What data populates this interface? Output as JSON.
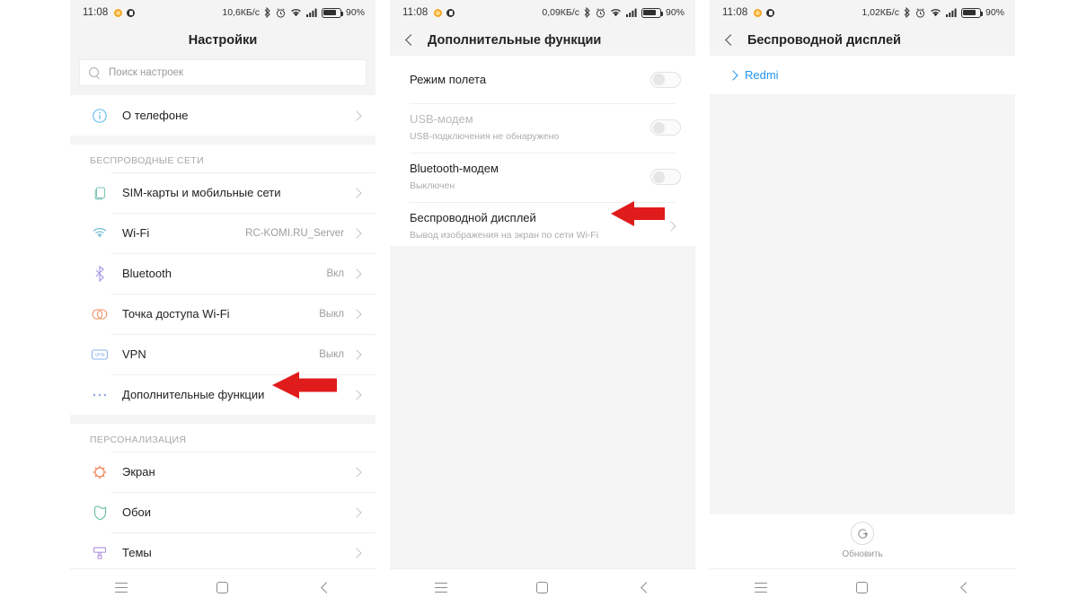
{
  "status_bar": {
    "time": "11:08",
    "battery_percent": "90%",
    "speeds": {
      "p1": "10,6КБ/c",
      "p2": "0,09КБ/c",
      "p3": "1,02КБ/c"
    },
    "icons": [
      "weather-dot-icon",
      "app-dot-icon",
      "bluetooth-icon",
      "alarm-icon",
      "wifi-icon",
      "signal-icon",
      "battery-icon"
    ]
  },
  "panel1": {
    "title": "Настройки",
    "search": {
      "placeholder": "Поиск настроек"
    },
    "about_row": {
      "label": "О телефоне",
      "icon": "info-circle-icon"
    },
    "group1_header": "БЕСПРОВОДНЫЕ СЕТИ",
    "group1_rows": [
      {
        "label": "SIM-карты и мобильные сети",
        "value": "",
        "icon": "sim-card-icon"
      },
      {
        "label": "Wi-Fi",
        "value": "RC-KOMI.RU_Server",
        "icon": "wifi-icon"
      },
      {
        "label": "Bluetooth",
        "value": "Вкл",
        "icon": "bluetooth-icon"
      },
      {
        "label": "Точка доступа Wi-Fi",
        "value": "Выкл",
        "icon": "hotspot-icon"
      },
      {
        "label": "VPN",
        "value": "Выкл",
        "icon": "vpn-icon"
      },
      {
        "label": "Дополнительные функции",
        "value": "",
        "icon": "more-dots-icon"
      }
    ],
    "group2_header": "ПЕРСОНАЛИЗАЦИЯ",
    "group2_rows": [
      {
        "label": "Экран",
        "value": "",
        "icon": "display-icon"
      },
      {
        "label": "Обои",
        "value": "",
        "icon": "wallpaper-icon"
      },
      {
        "label": "Темы",
        "value": "",
        "icon": "themes-icon"
      }
    ]
  },
  "panel2": {
    "title": "Дополнительные функции",
    "rows": [
      {
        "title": "Режим полета",
        "sub": "",
        "control": "toggle-off",
        "dim": false
      },
      {
        "title": "USB-модем",
        "sub": "USB-подключения не обнаружено",
        "control": "toggle-off",
        "dim": true
      },
      {
        "title": "Bluetooth-модем",
        "sub": "Выключен",
        "control": "toggle-off",
        "dim": false
      },
      {
        "title": "Беспроводной дисплей",
        "sub": "Вывод изображения на экран по сети Wi-Fi",
        "control": "chevron",
        "dim": false
      }
    ]
  },
  "panel3": {
    "title": "Беспроводной дисплей",
    "device_link": "Redmi",
    "refresh_label": "Обновить",
    "refresh_icon": "refresh-circular-arrow-icon"
  },
  "nav_bar": {
    "menu": "menu-icon",
    "home": "home-square-icon",
    "back": "back-chevron-icon"
  },
  "annotations": {
    "arrow_color": "#e01b1b",
    "arrow1_target": "Дополнительные функции",
    "arrow2_target": "Беспроводной дисплей"
  }
}
